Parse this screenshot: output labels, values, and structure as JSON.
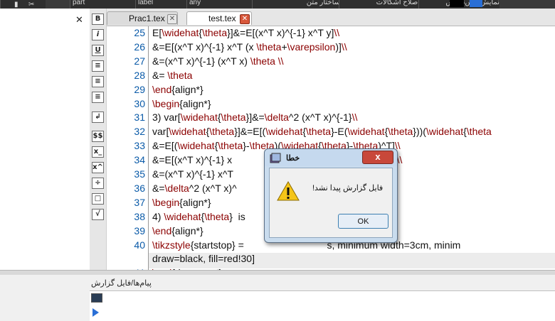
{
  "toolbar": {
    "items": [
      "part",
      "label",
      "any",
      "ساختار متن",
      "اصلاح اشکالات",
      "نمایش پیش‌نمایش"
    ]
  },
  "tabs": [
    {
      "label": "Prac1.tex",
      "active": false
    },
    {
      "label": "test.tex",
      "active": true
    }
  ],
  "format_tools": [
    "B",
    "i",
    "U",
    "≡",
    "≡",
    "≡",
    "↲",
    "$$",
    "x_",
    "x^",
    "÷",
    "□",
    "√"
  ],
  "editor": {
    "lines": [
      {
        "num": "25",
        "text": "E[\\widehat{\\theta}]&=E[(x^T x)^{-1} x^T y]\\\\"
      },
      {
        "num": "26",
        "text": "&=E[(x^T x)^{-1} x^T (x \\theta+\\varepsilon)]\\\\"
      },
      {
        "num": "27",
        "text": "&=(x^T x)^{-1} (x^T x) \\theta \\\\"
      },
      {
        "num": "28",
        "text": "&= \\theta"
      },
      {
        "num": "29",
        "text": "\\end{align*}"
      },
      {
        "num": "30",
        "text": "\\begin{align*}"
      },
      {
        "num": "31",
        "text": "3) var[\\widehat{\\theta}]&=\\delta^2 (x^T x)^{-1}\\\\"
      },
      {
        "num": "32",
        "text": "var[\\widehat{\\theta}]&=E[(\\widehat{\\theta}-E(\\widehat{\\theta}))(\\widehat{\\theta"
      },
      {
        "num": "33",
        "text": "&=E[(\\widehat{\\theta}-\\theta)(\\widehat{\\theta}-\\theta)^T]\\\\"
      },
      {
        "num": "34",
        "text": "&=E[(x^T x)^{-1} x                               x^T x (x^T x)^{-1}]\\\\"
      },
      {
        "num": "35",
        "text": "&=(x^T x)^{-1} x^T                               T]  x (x^T x)^{-1}\\\\"
      },
      {
        "num": "36",
        "text": "&=\\delta^2 (x^T x)^"
      },
      {
        "num": "37",
        "text": "\\begin{align*}"
      },
      {
        "num": "38",
        "text": "4) \\widehat{\\theta}  is"
      },
      {
        "num": "39",
        "text": "\\end{align*}"
      },
      {
        "num": "40",
        "text": "\\tikzstyle{startstop} =                              s, minimum width=3cm, minim"
      },
      {
        "num": "",
        "text": "draw=black, fill=red!30]"
      },
      {
        "num": "41",
        "text": "\\end{document}"
      }
    ]
  },
  "log_panel": {
    "title": "پیام‌ها/فایل گزارش"
  },
  "dialog": {
    "title": "خطا",
    "message": "فایل گزارش پیدا نشد!",
    "ok_label": "OK",
    "close_symbol": "x"
  },
  "colors": {
    "line_number": "#0a5aa8",
    "command": "#8b0000",
    "dialog_close": "#c8483a"
  }
}
